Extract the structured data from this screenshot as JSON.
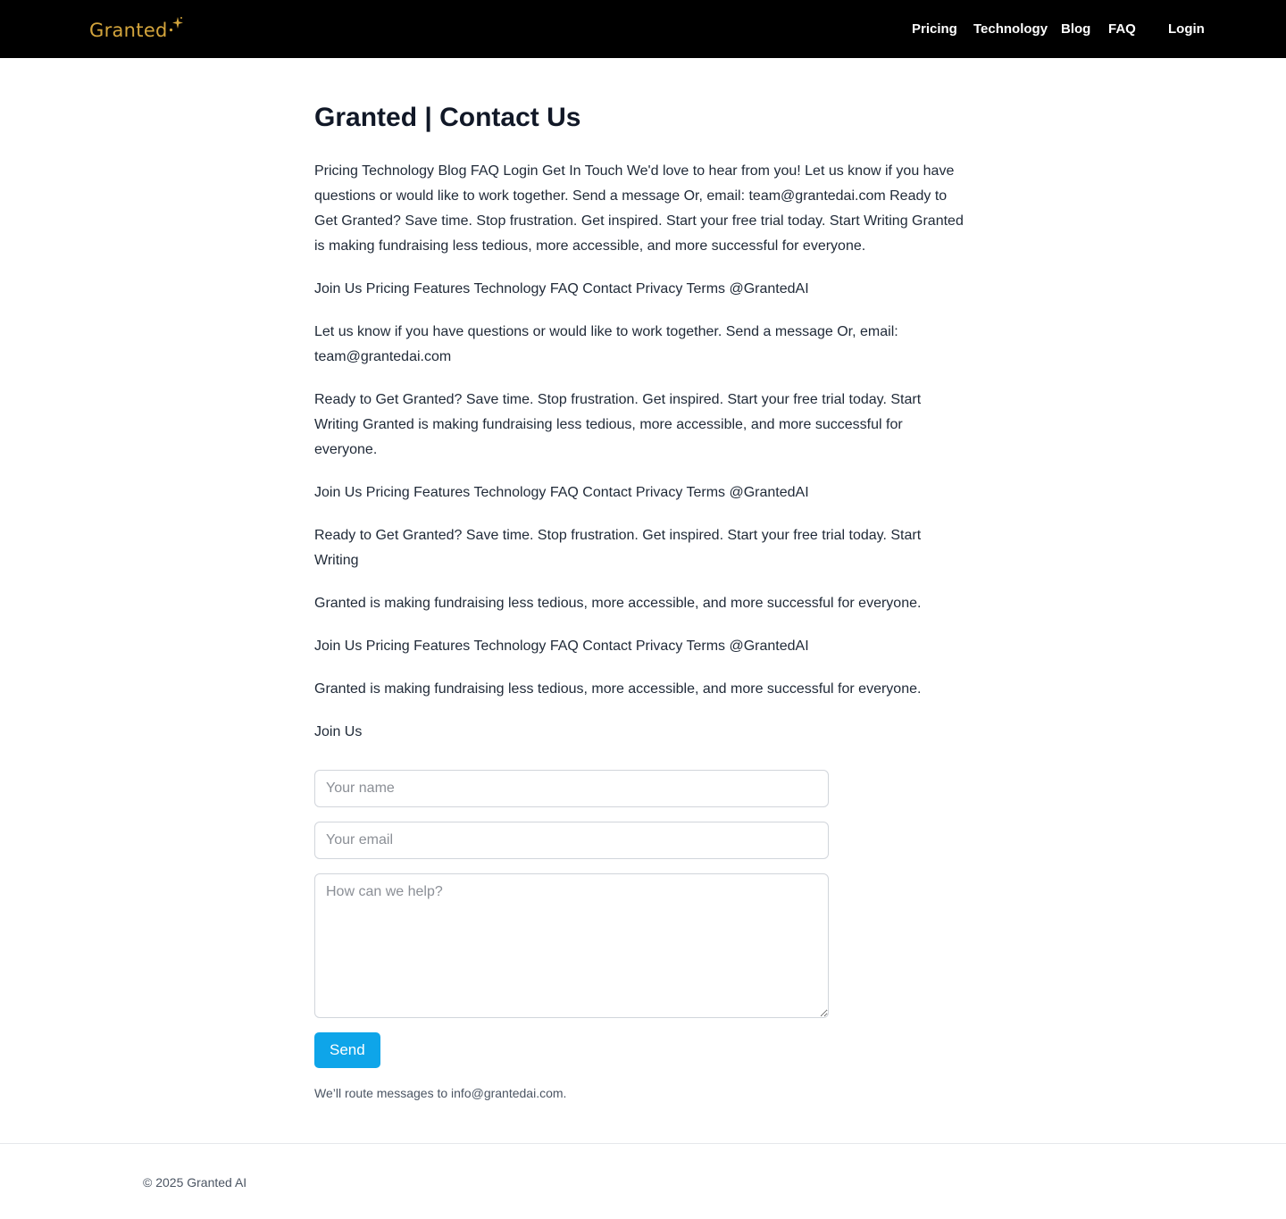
{
  "header": {
    "logo_text": "Granted",
    "brand_color": "#d4a53c",
    "nav": {
      "pricing": "Pricing",
      "technology": "Technology",
      "blog": "Blog",
      "faq": "FAQ",
      "login": "Login"
    }
  },
  "main": {
    "title": "Granted | Contact Us",
    "paragraphs": [
      "Pricing Technology Blog FAQ Login Get In Touch We'd love to hear from you! Let us know if you have questions or would like to work together. Send a message Or, email: team@grantedai.com Ready to Get Granted? Save time. Stop frustration. Get inspired. Start your free trial today. Start Writing Granted is making fundraising less tedious, more accessible, and more successful for everyone.",
      "Join Us Pricing Features Technology FAQ Contact Privacy Terms @GrantedAI",
      "Let us know if you have questions or would like to work together. Send a message Or, email: team@grantedai.com",
      "Ready to Get Granted? Save time. Stop frustration. Get inspired. Start your free trial today. Start Writing Granted is making fundraising less tedious, more accessible, and more successful for everyone.",
      "Join Us Pricing Features Technology FAQ Contact Privacy Terms @GrantedAI",
      "Ready to Get Granted? Save time. Stop frustration. Get inspired. Start your free trial today. Start Writing",
      "Granted is making fundraising less tedious, more accessible, and more successful for everyone.",
      "Join Us Pricing Features Technology FAQ Contact Privacy Terms @GrantedAI",
      "Granted is making fundraising less tedious, more accessible, and more successful for everyone.",
      "Join Us"
    ]
  },
  "form": {
    "name_placeholder": "Your name",
    "name_value": "",
    "email_placeholder": "Your email",
    "email_value": "",
    "message_placeholder": "How can we help?",
    "message_value": "",
    "send_label": "Send",
    "send_color": "#0ea5e9",
    "note": "We’ll route messages to info@grantedai.com."
  },
  "footer": {
    "copyright": "© 2025 Granted AI"
  }
}
